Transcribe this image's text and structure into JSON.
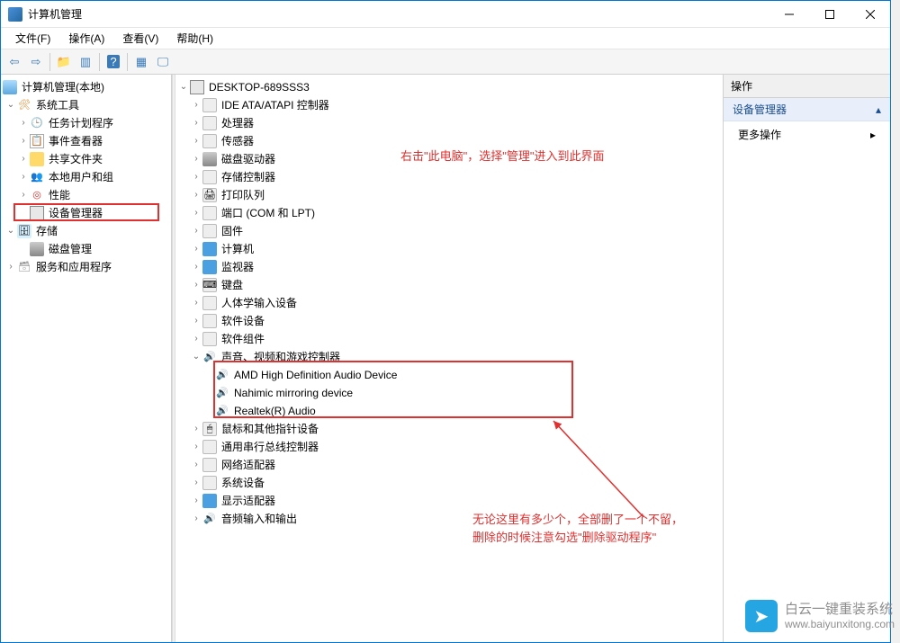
{
  "window": {
    "title": "计算机管理"
  },
  "menubar": {
    "file": "文件(F)",
    "action": "操作(A)",
    "view": "查看(V)",
    "help": "帮助(H)"
  },
  "left_tree": {
    "root": "计算机管理(本地)",
    "system_tools": "系统工具",
    "task_scheduler": "任务计划程序",
    "event_viewer": "事件查看器",
    "shared_folders": "共享文件夹",
    "local_users": "本地用户和组",
    "performance": "性能",
    "device_manager": "设备管理器",
    "storage": "存储",
    "disk_mgmt": "磁盘管理",
    "services_apps": "服务和应用程序"
  },
  "mid_tree": {
    "root": "DESKTOP-689SSS3",
    "ide": "IDE ATA/ATAPI 控制器",
    "cpu": "处理器",
    "sensor": "传感器",
    "cdrom": "磁盘驱动器",
    "storctrl": "存储控制器",
    "printq": "打印队列",
    "ports": "端口 (COM 和 LPT)",
    "firmware": "固件",
    "computer": "计算机",
    "monitor": "监视器",
    "keyboard": "键盘",
    "hid": "人体学输入设备",
    "swdev": "软件设备",
    "swcomp": "软件组件",
    "audio_cat": "声音、视频和游戏控制器",
    "audio1": "AMD High Definition Audio Device",
    "audio2": "Nahimic mirroring device",
    "audio3": "Realtek(R) Audio",
    "mouse": "鼠标和其他指针设备",
    "usb": "通用串行总线控制器",
    "net": "网络适配器",
    "sysdev": "系统设备",
    "display": "显示适配器",
    "audioio": "音频输入和输出"
  },
  "right": {
    "header": "操作",
    "section": "设备管理器",
    "more": "更多操作"
  },
  "annotations": {
    "top_text": "右击\"此电脑\"，选择\"管理\"进入到此界面",
    "bottom_text1": "无论这里有多少个，全部删了一个不留，",
    "bottom_text2": "删除的时候注意勾选\"删除驱动程序\""
  },
  "watermark": {
    "brand": "白云一键重装系统",
    "url": "www.baiyunxitong.com"
  }
}
